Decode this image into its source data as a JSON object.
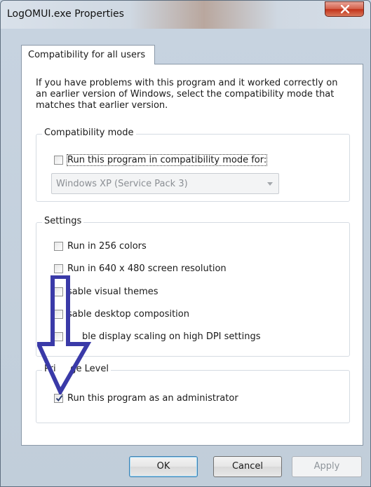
{
  "window": {
    "title": "LogOMUI.exe Properties"
  },
  "tabs": [
    {
      "label": "Compatibility for all users"
    }
  ],
  "intro_text": "If you have problems with this program and it worked correctly on an earlier version of Windows, select the compatibility mode that matches that earlier version.",
  "compatibility_mode": {
    "legend": "Compatibility mode",
    "checkbox_label": "Run this program in compatibility mode for:",
    "checked": false,
    "select_value": "Windows XP (Service Pack 3)"
  },
  "settings": {
    "legend": "Settings",
    "items": [
      {
        "label": "Run in 256 colors",
        "checked": false
      },
      {
        "label": "Run in 640 x 480 screen resolution",
        "checked": false
      },
      {
        "label": "sable visual themes",
        "checked": false
      },
      {
        "label": "sable desktop composition",
        "checked": false
      },
      {
        "label": "ble display scaling on high DPI settings",
        "checked": false
      }
    ]
  },
  "privilege": {
    "legend": "Pri     ge Level",
    "checkbox_label": "Run this program as an administrator",
    "checked": true
  },
  "buttons": {
    "ok": "OK",
    "cancel": "Cancel",
    "apply": "Apply"
  },
  "colors": {
    "arrow": "#3a3aa8",
    "close_red": "#c2321a"
  }
}
